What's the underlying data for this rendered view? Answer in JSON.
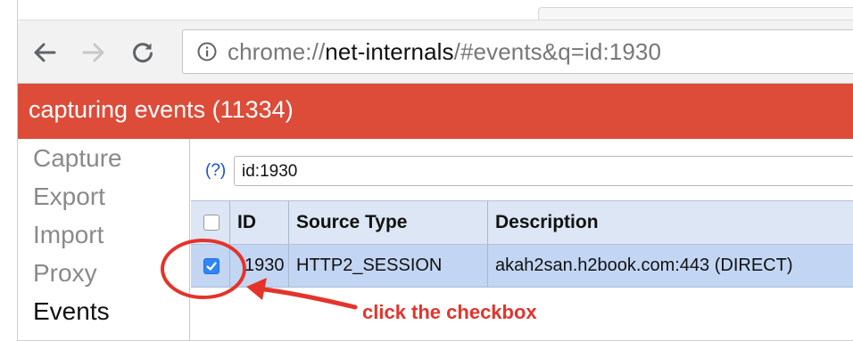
{
  "browser": {
    "back_icon": "back-arrow-icon",
    "forward_icon": "forward-arrow-icon",
    "reload_icon": "reload-icon",
    "info_icon": "info-icon",
    "url_prefix": "chrome://",
    "url_host": "net-internals",
    "url_suffix": "/#events&q=id:1930"
  },
  "banner": {
    "text": "capturing events (11334)",
    "color": "#dd4b39"
  },
  "sidebar": {
    "items": [
      {
        "label": "Capture",
        "active": false
      },
      {
        "label": "Export",
        "active": false
      },
      {
        "label": "Import",
        "active": false
      },
      {
        "label": "Proxy",
        "active": false
      },
      {
        "label": "Events",
        "active": true
      }
    ]
  },
  "filter": {
    "help_link": "(?)",
    "query": "id:1930"
  },
  "table": {
    "columns": [
      "ID",
      "Source Type",
      "Description"
    ],
    "rows": [
      {
        "checked": true,
        "id": "1930",
        "source_type": "HTTP2_SESSION",
        "description": "akah2san.h2book.com:443 (DIRECT)"
      }
    ]
  },
  "annotation": {
    "text": "click the checkbox",
    "color": "#e5332b"
  }
}
